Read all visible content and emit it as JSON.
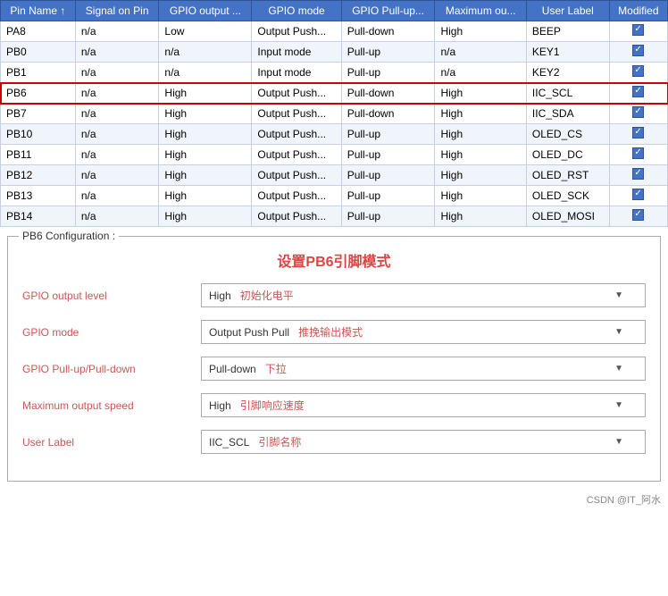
{
  "table": {
    "columns": [
      "Pin Name ↑",
      "Signal on Pin",
      "GPIO output ...",
      "GPIO mode",
      "GPIO Pull-up...",
      "Maximum ou...",
      "User Label",
      "Modified"
    ],
    "rows": [
      {
        "pin": "PA8",
        "signal": "n/a",
        "output": "Low",
        "mode": "Output Push...",
        "pull": "Pull-down",
        "max": "High",
        "label": "BEEP",
        "modified": true,
        "highlight": false
      },
      {
        "pin": "PB0",
        "signal": "n/a",
        "output": "n/a",
        "mode": "Input mode",
        "pull": "Pull-up",
        "max": "n/a",
        "label": "KEY1",
        "modified": true,
        "highlight": false
      },
      {
        "pin": "PB1",
        "signal": "n/a",
        "output": "n/a",
        "mode": "Input mode",
        "pull": "Pull-up",
        "max": "n/a",
        "label": "KEY2",
        "modified": true,
        "highlight": false
      },
      {
        "pin": "PB6",
        "signal": "n/a",
        "output": "High",
        "mode": "Output Push...",
        "pull": "Pull-down",
        "max": "High",
        "label": "IIC_SCL",
        "modified": true,
        "highlight": true
      },
      {
        "pin": "PB7",
        "signal": "n/a",
        "output": "High",
        "mode": "Output Push...",
        "pull": "Pull-down",
        "max": "High",
        "label": "IIC_SDA",
        "modified": true,
        "highlight": false
      },
      {
        "pin": "PB10",
        "signal": "n/a",
        "output": "High",
        "mode": "Output Push...",
        "pull": "Pull-up",
        "max": "High",
        "label": "OLED_CS",
        "modified": true,
        "highlight": false
      },
      {
        "pin": "PB11",
        "signal": "n/a",
        "output": "High",
        "mode": "Output Push...",
        "pull": "Pull-up",
        "max": "High",
        "label": "OLED_DC",
        "modified": true,
        "highlight": false
      },
      {
        "pin": "PB12",
        "signal": "n/a",
        "output": "High",
        "mode": "Output Push...",
        "pull": "Pull-up",
        "max": "High",
        "label": "OLED_RST",
        "modified": true,
        "highlight": false
      },
      {
        "pin": "PB13",
        "signal": "n/a",
        "output": "High",
        "mode": "Output Push...",
        "pull": "Pull-up",
        "max": "High",
        "label": "OLED_SCK",
        "modified": true,
        "highlight": false
      },
      {
        "pin": "PB14",
        "signal": "n/a",
        "output": "High",
        "mode": "Output Push...",
        "pull": "Pull-up",
        "max": "High",
        "label": "OLED_MOSI",
        "modified": true,
        "highlight": false
      }
    ]
  },
  "config": {
    "legend": "PB6 Configuration :",
    "title": "设置PB6引脚模式",
    "rows": [
      {
        "label": "GPIO output level",
        "value": "High",
        "comment": "初始化电平"
      },
      {
        "label": "GPIO mode",
        "value": "Output Push Pull",
        "comment": "推挽输出模式"
      },
      {
        "label": "GPIO Pull-up/Pull-down",
        "value": "Pull-down",
        "comment": "下拉"
      },
      {
        "label": "Maximum output speed",
        "value": "High",
        "comment": "引脚响应速度"
      },
      {
        "label": "User Label",
        "value": "IIC_SCL",
        "comment": "引脚名称"
      }
    ]
  },
  "watermark": "CSDN @IT_阿水"
}
